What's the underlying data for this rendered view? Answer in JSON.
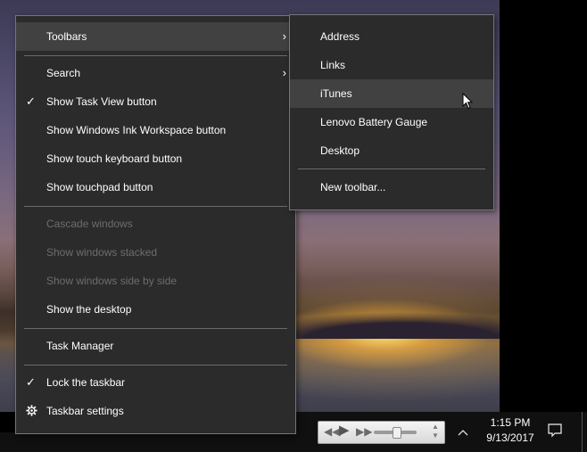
{
  "main_menu": {
    "toolbars": "Toolbars",
    "search": "Search",
    "show_task_view": "Show Task View button",
    "show_ink_workspace": "Show Windows Ink Workspace button",
    "show_touch_keyboard": "Show touch keyboard button",
    "show_touchpad": "Show touchpad button",
    "cascade_windows": "Cascade windows",
    "show_windows_stacked": "Show windows stacked",
    "show_windows_side_by_side": "Show windows side by side",
    "show_desktop": "Show the desktop",
    "task_manager": "Task Manager",
    "lock_taskbar": "Lock the taskbar",
    "taskbar_settings": "Taskbar settings"
  },
  "toolbars_submenu": {
    "address": "Address",
    "links": "Links",
    "itunes": "iTunes",
    "lenovo_battery": "Lenovo Battery Gauge",
    "desktop": "Desktop",
    "new_toolbar": "New toolbar..."
  },
  "taskbar": {
    "time": "1:15 PM",
    "date": "9/13/2017"
  },
  "icons": {
    "check": "check-icon",
    "submenu_arrow": "chevron-right-icon",
    "settings": "gear-icon",
    "tray_up": "chevron-up-icon",
    "notifications": "action-center-icon"
  },
  "colors": {
    "menu_bg": "#2b2b2b",
    "menu_highlight": "#414141",
    "menu_disabled_text": "#6d6d6d",
    "taskbar_bg": "#101010"
  }
}
